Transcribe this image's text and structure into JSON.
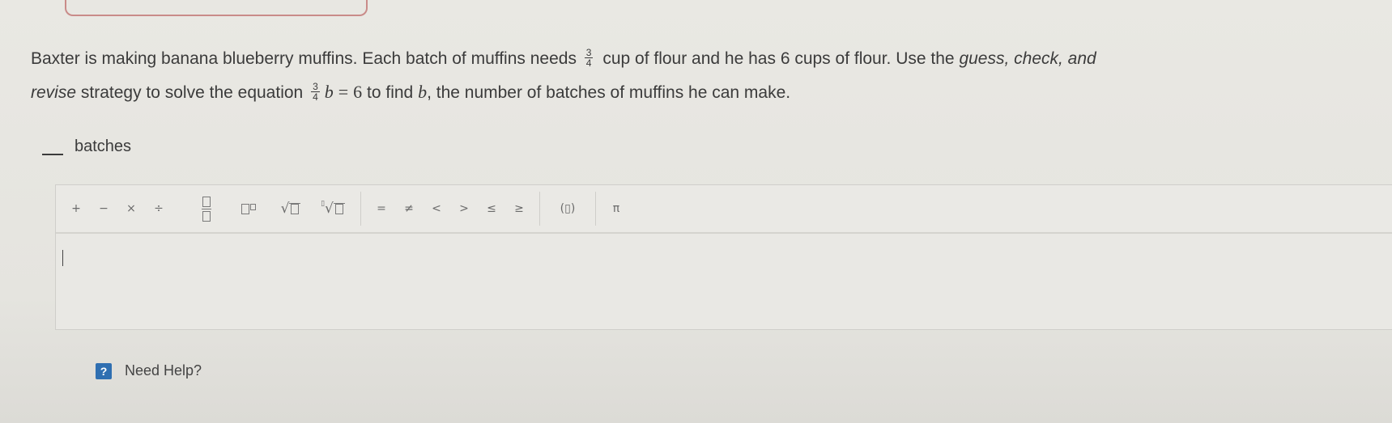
{
  "question": {
    "part1": "Baxter is making banana blueberry muffins. Each batch of muffins needs",
    "frac_num": "3",
    "frac_den": "4",
    "part2": "cup of flour and he has 6 cups of flour. Use the",
    "strategy": "guess, check, and",
    "part3": "revise",
    "part4": "strategy to solve the equation",
    "eq_num": "3",
    "eq_den": "4",
    "eq_var": "b",
    "eq_sign": "=",
    "eq_rhs": "6",
    "part5": "to find",
    "var_b": "b",
    "part6": ", the number of batches of muffins he can make."
  },
  "answer": {
    "unit_label": "batches"
  },
  "toolbar": {
    "ops": [
      "+",
      "−",
      "×",
      "÷"
    ],
    "relations": [
      "=",
      "≠",
      "<",
      ">",
      "≤",
      "≥"
    ],
    "paren_label": "(▯)",
    "pi_label": "π"
  },
  "help": {
    "icon": "?",
    "label": "Need Help?"
  }
}
